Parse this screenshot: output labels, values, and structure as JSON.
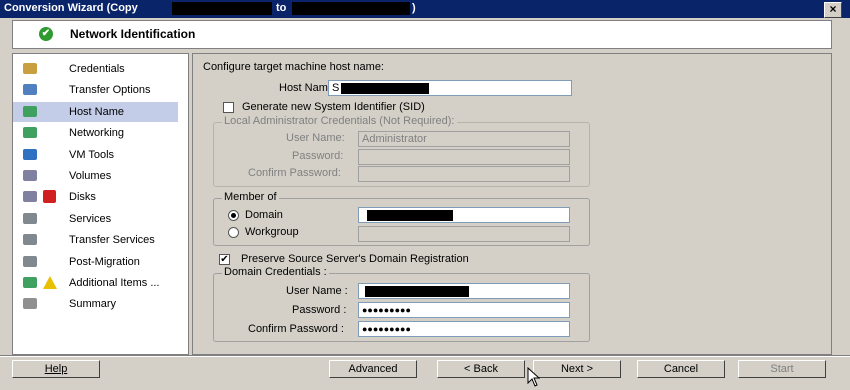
{
  "window": {
    "title_prefix": "Conversion Wizard (Copy",
    "title_mid": "to",
    "title_suffix": ")",
    "close_glyph": "×"
  },
  "header": {
    "title": "Network Identification",
    "check_glyph": "✔"
  },
  "nav": {
    "items": [
      {
        "label": "Credentials",
        "icon": "credentials-icon",
        "color": "#c8a040"
      },
      {
        "label": "Transfer Options",
        "icon": "transfer-options-icon",
        "color": "#5080c0"
      },
      {
        "label": "Host Name",
        "icon": "host-name-icon",
        "color": "#40a060",
        "selected": true
      },
      {
        "label": "Networking",
        "icon": "networking-icon",
        "color": "#40a060"
      },
      {
        "label": "VM Tools",
        "icon": "vm-tools-icon",
        "color": "#3070c0"
      },
      {
        "label": "Volumes",
        "icon": "volumes-icon",
        "color": "#8080a0"
      },
      {
        "label": "Disks",
        "icon": "disks-icon",
        "color": "#8080a0",
        "error": true
      },
      {
        "label": "Services",
        "icon": "services-icon",
        "color": "#808890"
      },
      {
        "label": "Transfer Services",
        "icon": "transfer-services-icon",
        "color": "#808890"
      },
      {
        "label": "Post-Migration",
        "icon": "post-migration-icon",
        "color": "#808890"
      },
      {
        "label": "Additional Items ...",
        "icon": "additional-items-icon",
        "color": "#40a060",
        "warning": true
      },
      {
        "label": "Summary",
        "icon": "summary-icon",
        "color": "#909090"
      }
    ]
  },
  "form": {
    "heading": "Configure target machine host name:",
    "host_name_label": "Host Name :",
    "host_name_value": "S",
    "generate_sid_label": "Generate new System Identifier (SID)",
    "generate_sid_checked": false,
    "local_admin_legend": "Local Administrator Credentials (Not Required):",
    "user_name_label": "User Name:",
    "user_name_value": "Administrator",
    "password_label": "Password:",
    "confirm_password_label": "Confirm Password:",
    "member_of_legend": "Member of",
    "domain_label": "Domain",
    "workgroup_label": "Workgroup",
    "domain_selected": true,
    "preserve_label": "Preserve Source Server's Domain Registration",
    "preserve_checked": true,
    "domain_credentials_legend": "Domain Credentials :",
    "dc_user_name_label": "User Name :",
    "dc_password_label": "Password :",
    "dc_password_value": "●●●●●●●●●",
    "dc_confirm_label": "Confirm Password :",
    "dc_confirm_value": "●●●●●●●●●"
  },
  "buttons": {
    "help": "Help",
    "advanced": "Advanced",
    "back": "< Back",
    "next": "Next >",
    "cancel": "Cancel",
    "start": "Start"
  },
  "colors": {
    "titlebar": "#0a246a",
    "selection": "#c3cde8",
    "face": "#d4d0c8"
  }
}
